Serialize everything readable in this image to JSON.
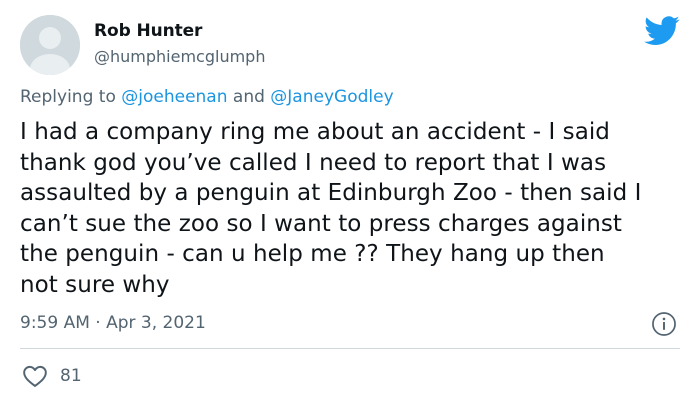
{
  "author": {
    "name": "Rob Hunter",
    "handle": "@humphiemcglumph"
  },
  "reply": {
    "prefix": "Replying to ",
    "mention_1": "@joeheenan",
    "connector": " and ",
    "mention_2": "@JaneyGodley"
  },
  "tweet": {
    "text": "I had a company ring me about an accident - I said\nthank god you’ve called I need to report that I was\nassaulted by a penguin at Edinburgh Zoo - then said I\ncan’t sue the zoo so I want to press charges against\nthe penguin - can u help me ?? They hang up then\nnot sure why",
    "timestamp": "9:59 AM · Apr 3, 2021"
  },
  "engagement": {
    "likes": "81"
  },
  "icons": {
    "brand": "twitter-bird-icon",
    "info": "info-icon",
    "like": "heart-icon"
  },
  "colors": {
    "brand_blue": "#1d9bf0",
    "mention_blue": "#1b95e0",
    "secondary_text": "#536471",
    "primary_text": "#0f1419"
  }
}
